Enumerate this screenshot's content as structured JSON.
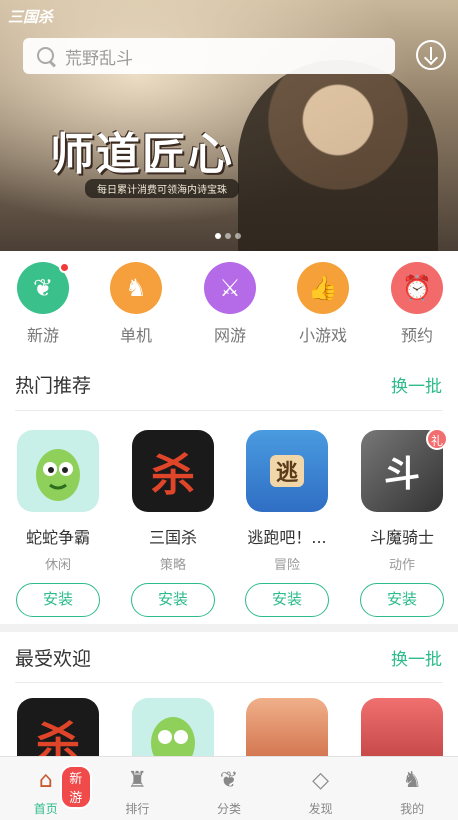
{
  "banner": {
    "logo": "三国杀",
    "search_placeholder": "荒野乱斗",
    "headline": "师道匠心",
    "subline": "每日累计消费可领海内诗宝珠",
    "dots": 3,
    "active_dot": 0
  },
  "categories": [
    {
      "label": "新游",
      "icon": "leaf-icon",
      "color": "#3ac08b",
      "has_dot": true
    },
    {
      "label": "单机",
      "icon": "chess-knight-icon",
      "color": "#f5a03c",
      "has_dot": false
    },
    {
      "label": "网游",
      "icon": "crossed-swords-icon",
      "color": "#b56ae8",
      "has_dot": false
    },
    {
      "label": "小游戏",
      "icon": "thumbs-up-icon",
      "color": "#f6a03a",
      "has_dot": false
    },
    {
      "label": "预约",
      "icon": "alarm-clock-icon",
      "color": "#f26a6a",
      "has_dot": false
    }
  ],
  "hot": {
    "title": "热门推荐",
    "more": "换一批",
    "games": [
      {
        "name": "蛇蛇争霸",
        "type": "休闲",
        "button": "安装",
        "icon": "snake-icon",
        "icon_text": "",
        "bg": "#c8f0e8"
      },
      {
        "name": "三国杀",
        "type": "策略",
        "button": "安装",
        "icon": "sanguosha-icon",
        "icon_text": "杀",
        "bg": "#1a1a1a"
      },
      {
        "name": "逃跑吧！...",
        "type": "冒险",
        "button": "安装",
        "icon": "runner-icon",
        "icon_text": "逃",
        "bg": "#4a9be0"
      },
      {
        "name": "斗魔骑士",
        "type": "动作",
        "button": "安装",
        "icon": "knight-icon",
        "icon_text": "斗",
        "bg": "#555555",
        "gift": "礼"
      }
    ]
  },
  "favorite": {
    "title": "最受欢迎",
    "more": "换一批",
    "games": [
      {
        "icon": "sanguosha-icon",
        "icon_text": "杀",
        "bg": "#1a1a1a"
      },
      {
        "icon": "snake-icon",
        "icon_text": "",
        "bg": "#c8f0e8"
      },
      {
        "icon": "heroine-icon",
        "icon_text": "",
        "bg": "#e88a5a"
      },
      {
        "icon": "princess-icon",
        "icon_text": "",
        "bg": "#e85a5a"
      }
    ]
  },
  "tabbar": {
    "badge": "新游",
    "tabs": [
      {
        "label": "首页",
        "icon": "windmill-icon",
        "glyph": "⌂",
        "active": true
      },
      {
        "label": "排行",
        "icon": "scarecrow-icon",
        "glyph": "♜",
        "active": false
      },
      {
        "label": "分类",
        "icon": "sprout-icon",
        "glyph": "❦",
        "active": false
      },
      {
        "label": "发现",
        "icon": "kite-icon",
        "glyph": "◇",
        "active": false
      },
      {
        "label": "我的",
        "icon": "squirrel-icon",
        "glyph": "♞",
        "active": false
      }
    ]
  }
}
